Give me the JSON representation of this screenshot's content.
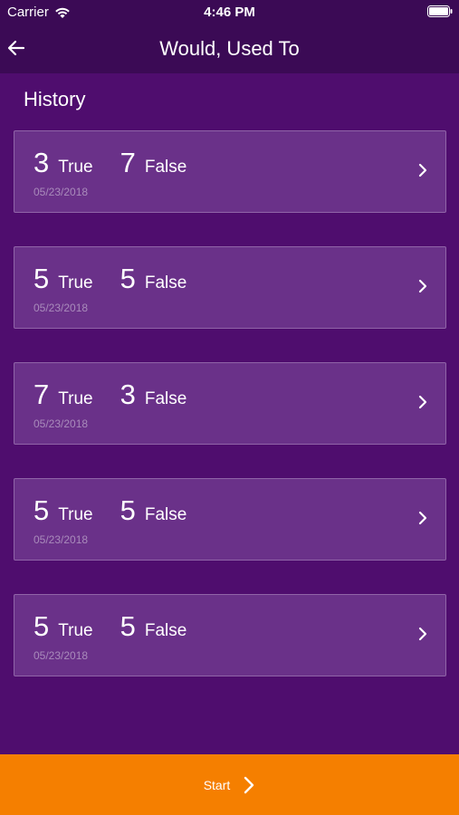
{
  "status_bar": {
    "carrier": "Carrier",
    "time": "4:46 PM",
    "wifi_icon": "wifi-icon",
    "battery_icon": "battery-icon"
  },
  "nav": {
    "title": "Would, Used To",
    "back_icon": "arrow-left-icon"
  },
  "history": {
    "heading": "History",
    "items": [
      {
        "true_count": "3",
        "true_label": "True",
        "false_count": "7",
        "false_label": "False",
        "date": "05/23/2018"
      },
      {
        "true_count": "5",
        "true_label": "True",
        "false_count": "5",
        "false_label": "False",
        "date": "05/23/2018"
      },
      {
        "true_count": "7",
        "true_label": "True",
        "false_count": "3",
        "false_label": "False",
        "date": "05/23/2018"
      },
      {
        "true_count": "5",
        "true_label": "True",
        "false_count": "5",
        "false_label": "False",
        "date": "05/23/2018"
      },
      {
        "true_count": "5",
        "true_label": "True",
        "false_count": "5",
        "false_label": "False",
        "date": "05/23/2018"
      }
    ]
  },
  "footer": {
    "start_label": "Start",
    "start_icon": "chevron-right-icon"
  },
  "colors": {
    "background": "#4f0d6e",
    "topbar": "#3b0a55",
    "card": "#6a3189",
    "card_border": "#9064a8",
    "accent": "#f57f00"
  }
}
